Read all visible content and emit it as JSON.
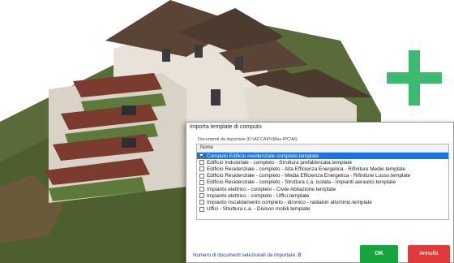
{
  "dialog": {
    "title": "Importa template di computo",
    "label": "Documenti da importare (D:\\ACCA\\PriMus-IPC\\AI)",
    "column_header": "Nome",
    "items": [
      {
        "label": "Computo Edificio residenziale completo.template",
        "checked": true,
        "selected": true
      },
      {
        "label": "Edificio Industriale - completo - Struttura prefabbricata.template",
        "checked": false,
        "selected": false
      },
      {
        "label": "Edificio Residenziale - completo - Alta Efficienza Energetica - Rifiniture Medie.template",
        "checked": false,
        "selected": false
      },
      {
        "label": "Edificio Residenziale - completo - Media Efficienza Energetica - Rifiniture Lusso.template",
        "checked": false,
        "selected": false
      },
      {
        "label": "Edificio Residenziale - completo - Struttura c.a. isolata - Impianti aeraulici.template",
        "checked": false,
        "selected": false
      },
      {
        "label": "Impianto elettrico - completo - Civile Abitazione.template",
        "checked": false,
        "selected": false
      },
      {
        "label": "Impianto elettrico - completo - Uffici.template",
        "checked": false,
        "selected": false
      },
      {
        "label": "Impianto riscaldamento completo - idronico - radiatori alluminio.template",
        "checked": false,
        "selected": false
      },
      {
        "label": "Uffici - Struttura c.a. - Divisori mobili.template",
        "checked": false,
        "selected": false
      }
    ],
    "count_label": "Numero di documenti selezionati da importare:",
    "count_value": "0",
    "ok_label": "OK",
    "cancel_label": "Annulla"
  },
  "colors": {
    "accent_green": "#3dba72",
    "ok_button": "#17a33e",
    "cancel_button": "#e03a3a",
    "selection": "#1874e0"
  },
  "icons": [
    "plus-icon"
  ]
}
